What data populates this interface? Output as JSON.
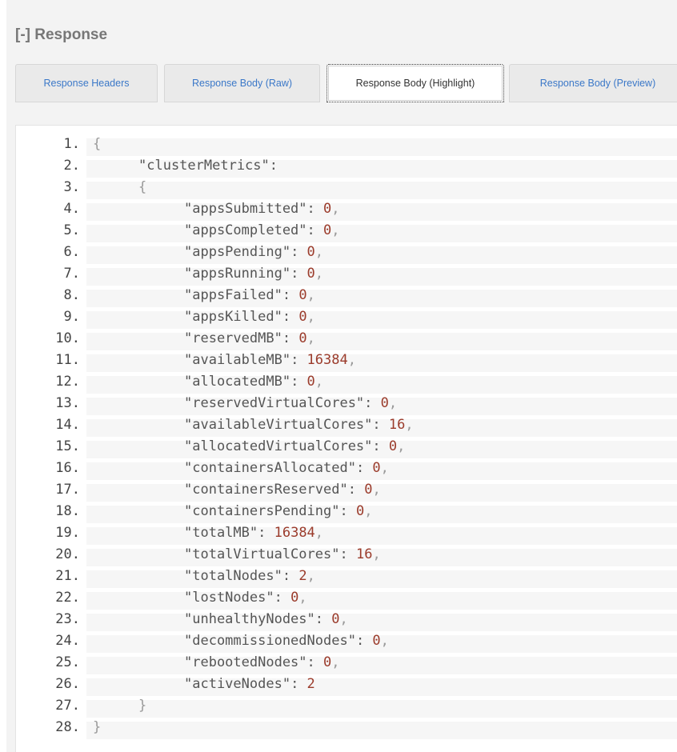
{
  "response": {
    "title": "[-] Response"
  },
  "tabs": [
    {
      "label": "Response Headers",
      "active": false
    },
    {
      "label": "Response Body (Raw)",
      "active": false
    },
    {
      "label": "Response Body (Highlight)",
      "active": true
    },
    {
      "label": "Response Body (Preview)",
      "active": false
    }
  ],
  "code": {
    "lines": [
      {
        "num": "1.",
        "indent": 0,
        "punct": "{"
      },
      {
        "num": "2.",
        "indent": 1,
        "key": "\"clusterMetrics\"",
        "punct": ":"
      },
      {
        "num": "3.",
        "indent": 1,
        "punct": "{"
      },
      {
        "num": "4.",
        "indent": 2,
        "key": "\"appsSubmitted\"",
        "sep": ": ",
        "value": "0",
        "tail": ","
      },
      {
        "num": "5.",
        "indent": 2,
        "key": "\"appsCompleted\"",
        "sep": ": ",
        "value": "0",
        "tail": ","
      },
      {
        "num": "6.",
        "indent": 2,
        "key": "\"appsPending\"",
        "sep": ": ",
        "value": "0",
        "tail": ","
      },
      {
        "num": "7.",
        "indent": 2,
        "key": "\"appsRunning\"",
        "sep": ": ",
        "value": "0",
        "tail": ","
      },
      {
        "num": "8.",
        "indent": 2,
        "key": "\"appsFailed\"",
        "sep": ": ",
        "value": "0",
        "tail": ","
      },
      {
        "num": "9.",
        "indent": 2,
        "key": "\"appsKilled\"",
        "sep": ": ",
        "value": "0",
        "tail": ","
      },
      {
        "num": "10.",
        "indent": 2,
        "key": "\"reservedMB\"",
        "sep": ": ",
        "value": "0",
        "tail": ","
      },
      {
        "num": "11.",
        "indent": 2,
        "key": "\"availableMB\"",
        "sep": ": ",
        "value": "16384",
        "tail": ","
      },
      {
        "num": "12.",
        "indent": 2,
        "key": "\"allocatedMB\"",
        "sep": ": ",
        "value": "0",
        "tail": ","
      },
      {
        "num": "13.",
        "indent": 2,
        "key": "\"reservedVirtualCores\"",
        "sep": ": ",
        "value": "0",
        "tail": ","
      },
      {
        "num": "14.",
        "indent": 2,
        "key": "\"availableVirtualCores\"",
        "sep": ": ",
        "value": "16",
        "tail": ","
      },
      {
        "num": "15.",
        "indent": 2,
        "key": "\"allocatedVirtualCores\"",
        "sep": ": ",
        "value": "0",
        "tail": ","
      },
      {
        "num": "16.",
        "indent": 2,
        "key": "\"containersAllocated\"",
        "sep": ": ",
        "value": "0",
        "tail": ","
      },
      {
        "num": "17.",
        "indent": 2,
        "key": "\"containersReserved\"",
        "sep": ": ",
        "value": "0",
        "tail": ","
      },
      {
        "num": "18.",
        "indent": 2,
        "key": "\"containersPending\"",
        "sep": ": ",
        "value": "0",
        "tail": ","
      },
      {
        "num": "19.",
        "indent": 2,
        "key": "\"totalMB\"",
        "sep": ": ",
        "value": "16384",
        "tail": ","
      },
      {
        "num": "20.",
        "indent": 2,
        "key": "\"totalVirtualCores\"",
        "sep": ": ",
        "value": "16",
        "tail": ","
      },
      {
        "num": "21.",
        "indent": 2,
        "key": "\"totalNodes\"",
        "sep": ": ",
        "value": "2",
        "tail": ","
      },
      {
        "num": "22.",
        "indent": 2,
        "key": "\"lostNodes\"",
        "sep": ": ",
        "value": "0",
        "tail": ","
      },
      {
        "num": "23.",
        "indent": 2,
        "key": "\"unhealthyNodes\"",
        "sep": ": ",
        "value": "0",
        "tail": ","
      },
      {
        "num": "24.",
        "indent": 2,
        "key": "\"decommissionedNodes\"",
        "sep": ": ",
        "value": "0",
        "tail": ","
      },
      {
        "num": "25.",
        "indent": 2,
        "key": "\"rebootedNodes\"",
        "sep": ": ",
        "value": "0",
        "tail": ","
      },
      {
        "num": "26.",
        "indent": 2,
        "key": "\"activeNodes\"",
        "sep": ": ",
        "value": "2",
        "tail": ""
      },
      {
        "num": "27.",
        "indent": 1,
        "punct": "}"
      },
      {
        "num": "28.",
        "indent": 0,
        "punct": "}"
      }
    ]
  },
  "colors": {
    "link": "#3b78c8",
    "number": "#9b3b2b",
    "key": "#555555",
    "punctuation": "#999999"
  }
}
